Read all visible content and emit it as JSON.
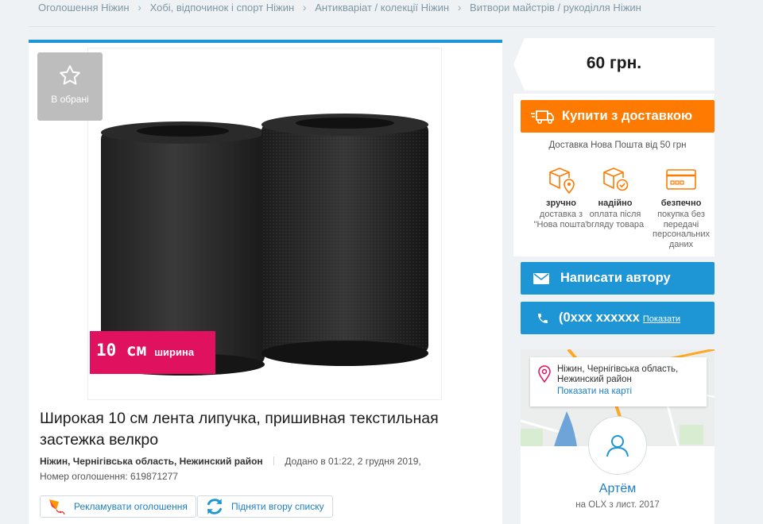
{
  "breadcrumb": [
    {
      "label": "Оголошення Ніжин"
    },
    {
      "label": "Хобі, відпочинок і спорт Ніжин"
    },
    {
      "label": "Антикваріат / колекції Ніжин"
    },
    {
      "label": "Витвори майстрів / рукоділля Ніжин"
    }
  ],
  "listing": {
    "favorite_label": "В обрані",
    "photo_badge_size": "10 см",
    "photo_badge_word": "ширина",
    "title": "Широкая 10 см лента липучка, пришивная текстильная застежка велкро",
    "location": "Ніжин, Чернігівська область, Нежинский район",
    "added": "Додано в 01:22, 2 грудня 2019,",
    "ad_number": "Номер оголошення: 619871277",
    "promote_label": "Рекламувати оголошення",
    "raise_label": "Підняти вгору списку"
  },
  "sidebar": {
    "price": "60 грн.",
    "buy_button": "Купити з доставкою",
    "delivery_note": "Доставка Нова Пошта від 50 грн",
    "features": [
      {
        "icon": "box-location-icon",
        "title": "зручно",
        "desc": "доставка з \"Нова пошта\""
      },
      {
        "icon": "box-check-icon",
        "title": "надійно",
        "desc": "оплата після огляду товара"
      },
      {
        "icon": "card-icon",
        "title": "безпечно",
        "desc": "покупка без передачі персональних даних"
      }
    ],
    "message_button": "Написати автору",
    "phone": "(0xxx xxxxxx",
    "phone_show": "Показати",
    "address": "Ніжин, Чернігівська область, Нежинский район",
    "show_on_map": "Показати на карті",
    "author_name": "Артём",
    "author_since": "на OLX з лист. 2017"
  },
  "colors": {
    "accent_blue": "#1e96d6",
    "buy_orange": "#ff7a00",
    "badge_pink": "#e0115f"
  }
}
